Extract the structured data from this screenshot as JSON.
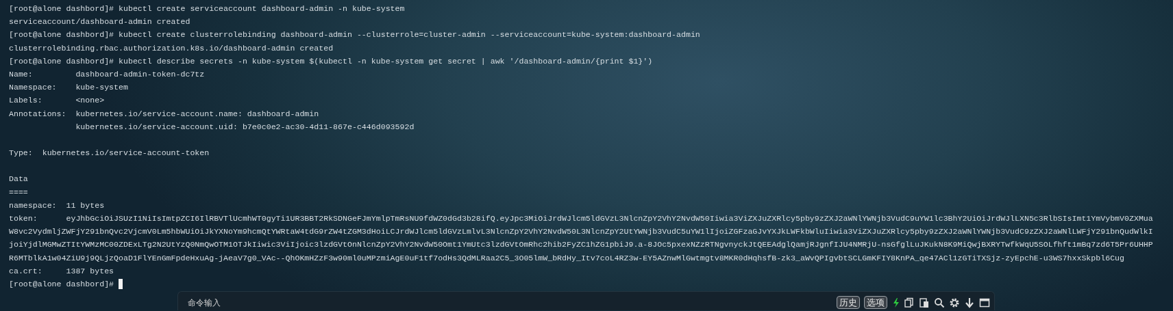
{
  "terminal": {
    "lines": [
      {
        "kind": "command",
        "prompt": "[root@alone dashbord]#",
        "text": "kubectl create serviceaccount dashboard-admin -n kube-system"
      },
      {
        "kind": "output",
        "text": "serviceaccount/dashboard-admin created"
      },
      {
        "kind": "command",
        "prompt": "[root@alone dashbord]#",
        "text": "kubectl create clusterrolebinding dashboard-admin --clusterrole=cluster-admin --serviceaccount=kube-system:dashboard-admin"
      },
      {
        "kind": "output",
        "text": "clusterrolebinding.rbac.authorization.k8s.io/dashboard-admin created"
      },
      {
        "kind": "command",
        "prompt": "[root@alone dashbord]#",
        "text": "kubectl describe secrets -n kube-system $(kubectl -n kube-system get secret | awk '/dashboard-admin/{print $1}')"
      },
      {
        "kind": "output",
        "text": "Name:         dashboard-admin-token-dc7tz"
      },
      {
        "kind": "output",
        "text": "Namespace:    kube-system"
      },
      {
        "kind": "output",
        "text": "Labels:       <none>"
      },
      {
        "kind": "output",
        "text": "Annotations:  kubernetes.io/service-account.name: dashboard-admin"
      },
      {
        "kind": "output",
        "text": "              kubernetes.io/service-account.uid: b7e0c0e2-ac30-4d11-867e-c446d093592d"
      },
      {
        "kind": "blank"
      },
      {
        "kind": "output",
        "text": "Type:  kubernetes.io/service-account-token"
      },
      {
        "kind": "blank"
      },
      {
        "kind": "output",
        "text": "Data"
      },
      {
        "kind": "output",
        "text": "===="
      },
      {
        "kind": "output",
        "text": "namespace:  11 bytes"
      },
      {
        "kind": "output",
        "text": "token:      eyJhbGciOiJSUzI1NiIsImtpZCI6IlRBVTlUcmhWT0gyTi1UR3BBT2RkSDNGeFJmYmlpTmRsNU9fdWZ0dGd3b28ifQ.eyJpc3MiOiJrdWJlcm5ldGVzL3NlcnZpY2VhY2NvdW50Iiwia3ViZXJuZXRlcy5pby9zZXJ2aWNlYWNjb3VudC9uYW1lc3BhY2UiOiJrdWJlLXN5c3RlbSIsImt1YmVybmV0ZXMua"
      },
      {
        "kind": "output",
        "text": "W8vc2VydmljZWFjY291bnQvc2VjcmV0Lm5hbWUiOiJkYXNoYm9hcmQtYWRtaW4tdG9rZW4tZGM3dHoiLCJrdWJlcm5ldGVzLmlvL3NlcnZpY2VhY2NvdW50L3NlcnZpY2UtYWNjb3VudC5uYW1lIjoiZGFzaGJvYXJkLWFkbWluIiwia3ViZXJuZXRlcy5pby9zZXJ2aWNlYWNjb3VudC9zZXJ2aWNlLWFjY291bnQudWlkI"
      },
      {
        "kind": "output",
        "text": "joiYjdlMGMwZTItYWMzMC00ZDExLTg2N2UtYzQ0NmQwOTM1OTJkIiwic3ViIjoic3lzdGVtOnNlcnZpY2VhY2NvdW50Omt1YmUtc3lzdGVtOmRhc2hib2FyZC1hZG1pbiJ9.a-8JOc5pxexNZzRTNgvnyckJtQEEAdglQamjRJgnfIJU4NMRjU-nsGfglLuJKukN8K9MiQwjBXRYTwfkWqU5SOLfhft1mBq7zd6T5Pr6UHHP"
      },
      {
        "kind": "output",
        "text": "R6MTblkA1w04ZiU9j9QLjzQoaD1FlYEnGmFpdeHxuAg-jAeaV7g0_VAc--QhOKmHZzF3w90ml0uMPzmiAgE0uF1tf7odHs3QdMLRaa2C5_3O05lmW_bRdHy_Itv7coL4RZ3w-EY5AZnwMlGwtmgtv8MKR0dHqhsfB-zk3_aWvQPIgvbtSCLGmKFIY8KnPA_qe47ACl1zGTiTXSjz-zyEpchE-u3WS7hxxSkpbl6Cug"
      },
      {
        "kind": "output",
        "text": "ca.crt:     1387 bytes"
      },
      {
        "kind": "command",
        "prompt": "[root@alone dashbord]#",
        "cursor": true
      }
    ]
  },
  "command_bar": {
    "placeholder": "命令输入",
    "buttons": [
      {
        "label": "历史"
      },
      {
        "label": "选项"
      }
    ]
  }
}
